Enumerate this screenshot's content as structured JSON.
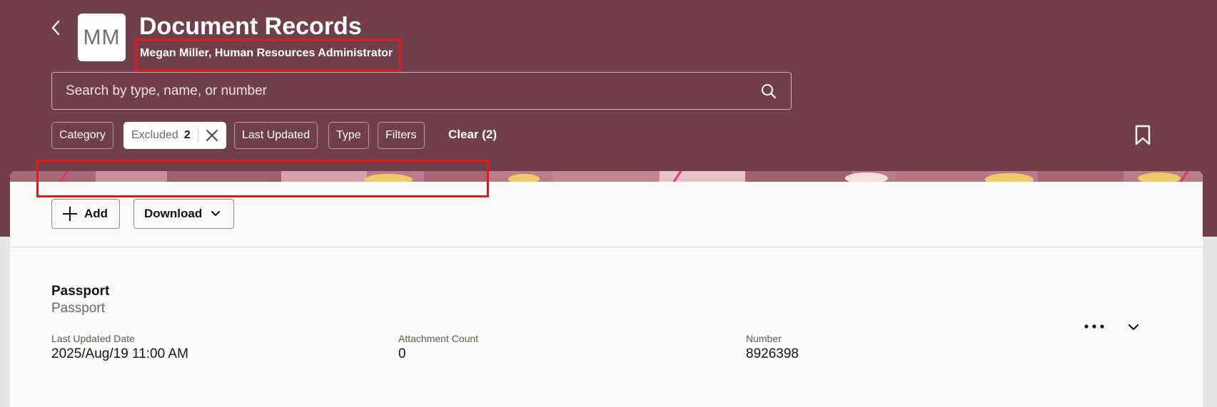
{
  "header": {
    "avatar_initials": "MM",
    "title": "Document Records",
    "subtitle": "Megan Miller, Human Resources Administrator"
  },
  "search": {
    "placeholder": "Search by type, name, or number",
    "value": ""
  },
  "filters": {
    "chips": {
      "category": "Category",
      "excluded_label": "Excluded",
      "excluded_count": "2",
      "last_updated": "Last Updated",
      "type": "Type",
      "filters": "Filters"
    },
    "clear_label": "Clear (2)"
  },
  "toolbar": {
    "add_label": "Add",
    "download_label": "Download"
  },
  "record": {
    "title": "Passport",
    "subtitle": "Passport",
    "fields": [
      {
        "label": "Last Updated Date",
        "value": "2025/Aug/19 11:00 AM"
      },
      {
        "label": "Attachment Count",
        "value": "0"
      },
      {
        "label": "Number",
        "value": "8926398"
      }
    ]
  },
  "colors": {
    "header_bg": "#703f4b",
    "card_bg": "#fbf9f8",
    "highlight": "#e01b1b"
  },
  "icons": {
    "back": "chevron-left-icon",
    "search": "search-icon",
    "close": "close-icon",
    "bookmark": "bookmark-icon",
    "add": "plus-icon",
    "download_caret": "chevron-down-icon",
    "more": "more-icon",
    "expand": "chevron-down-icon"
  }
}
